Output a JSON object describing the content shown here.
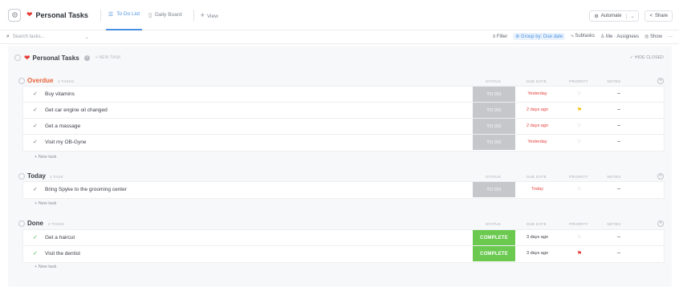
{
  "header": {
    "title": "Personal Tasks",
    "tabs": [
      {
        "label": "To Do List",
        "active": true
      },
      {
        "label": "Daily Board",
        "active": false
      }
    ],
    "add_view_label": "View",
    "automate_label": "Automate",
    "share_label": "Share"
  },
  "toolbar": {
    "search_placeholder": "Search tasks...",
    "filter_label": "Filter",
    "group_by_label": "Group by: Due date",
    "subtasks_label": "Subtasks",
    "assignees_label": "Me · Assignees",
    "show_label": "Show",
    "more_label": "···"
  },
  "list": {
    "title": "Personal Tasks",
    "new_task_label": "+ NEW TASK",
    "hide_closed_label": "✓ HIDE CLOSED"
  },
  "columns": {
    "status": "STATUS",
    "due": "DUE DATE",
    "priority": "PRIORITY",
    "notes": "NOTES"
  },
  "groups": [
    {
      "name": "Overdue",
      "color": "#e8633a",
      "count_label": "4 TASKS",
      "tasks": [
        {
          "name": "Buy vitamins",
          "status": "TO DO",
          "due": "Yesterday",
          "notes": "–"
        },
        {
          "name": "Get car engine oil changed",
          "status": "TO DO",
          "due": "2 days ago",
          "notes": "–"
        },
        {
          "name": "Get a massage",
          "status": "TO DO",
          "due": "2 days ago",
          "notes": "–"
        },
        {
          "name": "Visit my OB-Gyne",
          "status": "TO DO",
          "due": "Yesterday",
          "notes": "–"
        }
      ],
      "new_task": "+ New task"
    },
    {
      "name": "Today",
      "color": "#3a3d45",
      "count_label": "1 TASK",
      "tasks": [
        {
          "name": "Bring Spyke to the grooming center",
          "status": "TO DO",
          "due": "Today",
          "notes": "–"
        }
      ],
      "new_task": "+ New task"
    },
    {
      "name": "Done",
      "color": "#3a3d45",
      "count_label": "2 TASKS",
      "tasks": [
        {
          "name": "Get a haircut",
          "status": "COMPLETE",
          "due": "3 days ago",
          "notes": "–"
        },
        {
          "name": "Visit the dentist",
          "status": "COMPLETE",
          "due": "3 days ago",
          "notes": "–"
        }
      ],
      "new_task": "+ New task"
    }
  ],
  "colors": {
    "accent": "#4a90e2",
    "todo_status": "#c6c7cb",
    "complete_status": "#6bc950",
    "overdue_red": "#e8403b",
    "priority_yellow": "#f5c211",
    "priority_red": "#e53935"
  }
}
